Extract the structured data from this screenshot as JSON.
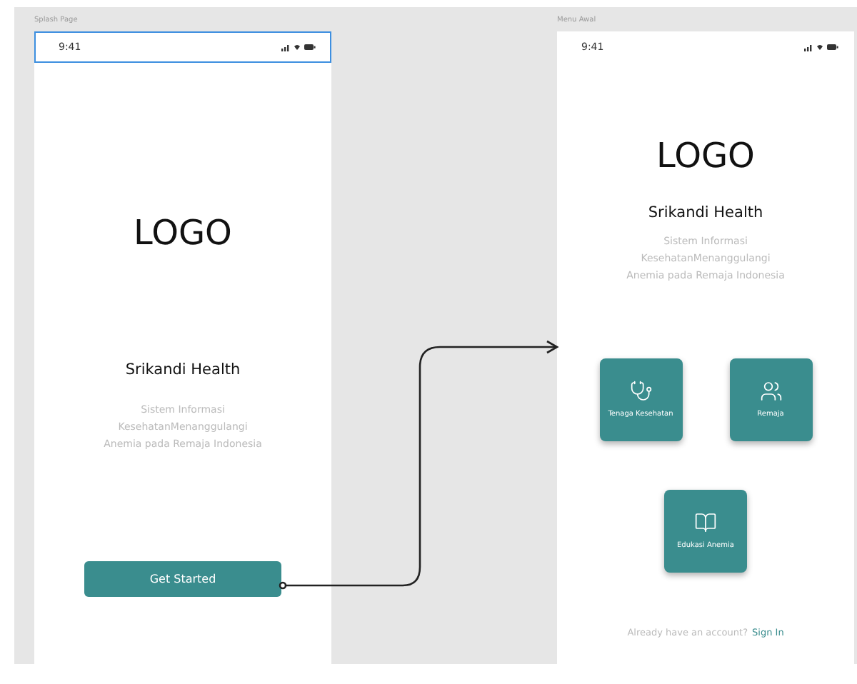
{
  "frames": [
    {
      "kind": "splash",
      "label": "Splash Page",
      "status_bar": {
        "time": "9:41",
        "selected": true
      },
      "logo": "LOGO",
      "title": "Srikandi Health",
      "description": [
        "Sistem Informasi",
        "KesehatanMenanggulangi",
        "Anemia pada Remaja Indonesia"
      ],
      "button": "Get Started"
    },
    {
      "kind": "menu",
      "label": "Menu Awal",
      "status_bar": {
        "time": "9:41",
        "selected": false
      },
      "logo": "LOGO",
      "title": "Srikandi Health",
      "description": [
        "Sistem Informasi",
        "KesehatanMenanggulangi",
        "Anemia pada Remaja Indonesia"
      ],
      "menu": [
        {
          "label": "Tenaga Kesehatan"
        },
        {
          "label": "Remaja"
        },
        {
          "label": "Edukasi Anemia"
        }
      ],
      "footer": {
        "text": "Already have an account?",
        "link": "Sign In"
      }
    }
  ]
}
